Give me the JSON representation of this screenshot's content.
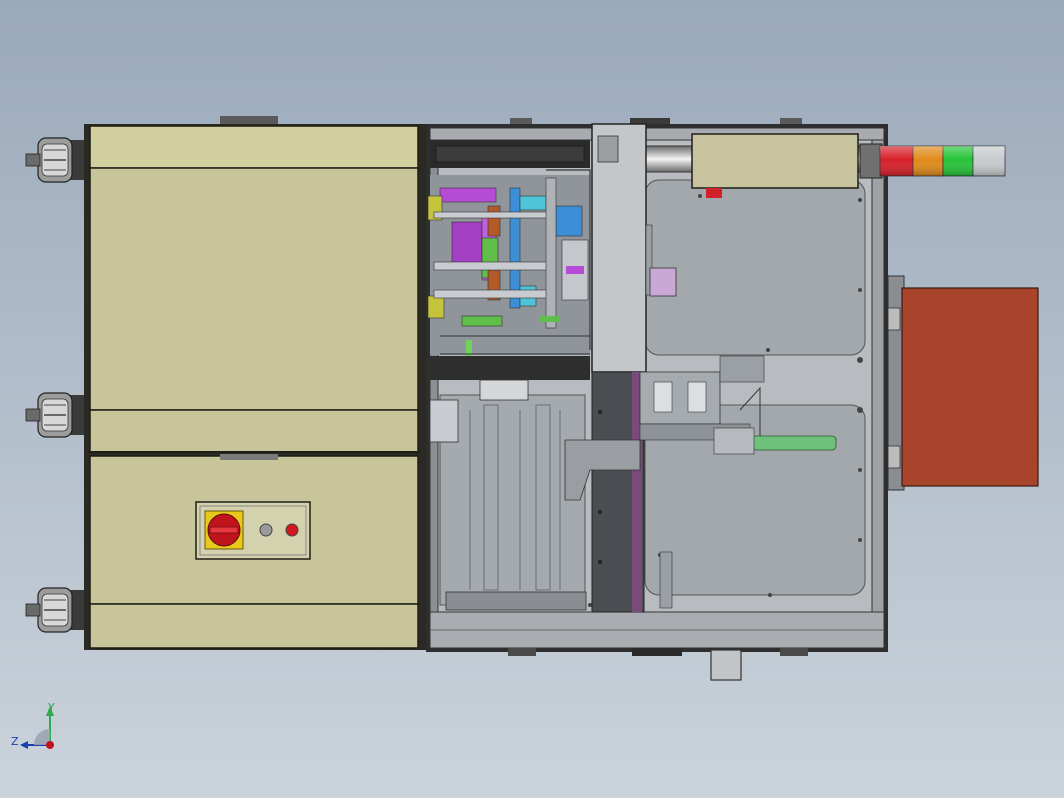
{
  "scene": {
    "colors": {
      "background_top": "#9aa9bb",
      "background_bottom": "#cbd3db",
      "cabinet_panel": "#c9c59a",
      "cabinet_edge": "#2a2a22",
      "frame_metal": "#b8bcc0",
      "inner_floor": "#9ea3a8",
      "dark_rail": "#3c3c3c",
      "orange_plate": "#a9442c",
      "magenta_part": "#b64bd6",
      "green_part": "#5fbf4a",
      "blue_part": "#3c8fd6",
      "cyan_part": "#4fc3d8",
      "yellow_part": "#c4c43a",
      "switch_red": "#c0141c",
      "switch_yellow": "#e8c81a"
    },
    "tower_light": {
      "segments": [
        "red",
        "orange",
        "green",
        "white"
      ],
      "segment_colors": [
        "#d8202a",
        "#e08a1a",
        "#27c43a",
        "#c8cccf"
      ]
    },
    "control_panel": {
      "items": [
        "main-switch",
        "indicator-lamp-grey",
        "indicator-lamp-red"
      ]
    },
    "casters": [
      "caster-top",
      "caster-middle",
      "caster-bottom"
    ],
    "axis_triad": {
      "y_label": "Y",
      "z_label": "Z",
      "y_color": "#2fa84f",
      "z_color": "#1a3fb0",
      "origin_color": "#c0141c"
    }
  }
}
